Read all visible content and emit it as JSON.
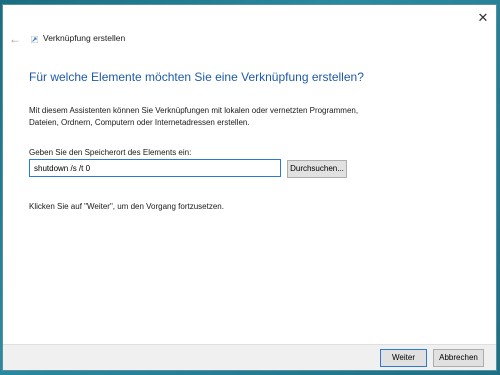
{
  "window": {
    "title": "Verknüpfung erstellen",
    "close_glyph": "✕",
    "back_glyph": "←"
  },
  "main": {
    "heading": "Für welche Elemente möchten Sie eine Verknüpfung erstellen?",
    "description_line1": "Mit diesem Assistenten können Sie Verknüpfungen mit lokalen oder vernetzten Programmen,",
    "description_line2": "Dateien, Ordnern, Computern oder Internetadressen erstellen.",
    "location_label": "Geben Sie den Speicherort des Elements ein:",
    "location_value": "shutdown /s /t 0",
    "browse_label": "Durchsuchen...",
    "instruction": "Klicken Sie auf \"Weiter\", um den Vorgang fortzusetzen."
  },
  "footer": {
    "next_label": "Weiter",
    "cancel_label": "Abbrechen"
  },
  "colors": {
    "accent": "#1e5aa8",
    "focus_border": "#2b79d4",
    "desktop": "#1e6f84"
  },
  "icons": {
    "title_icon": "shortcut-icon",
    "back_icon": "back-arrow-icon",
    "close_icon": "close-icon"
  }
}
